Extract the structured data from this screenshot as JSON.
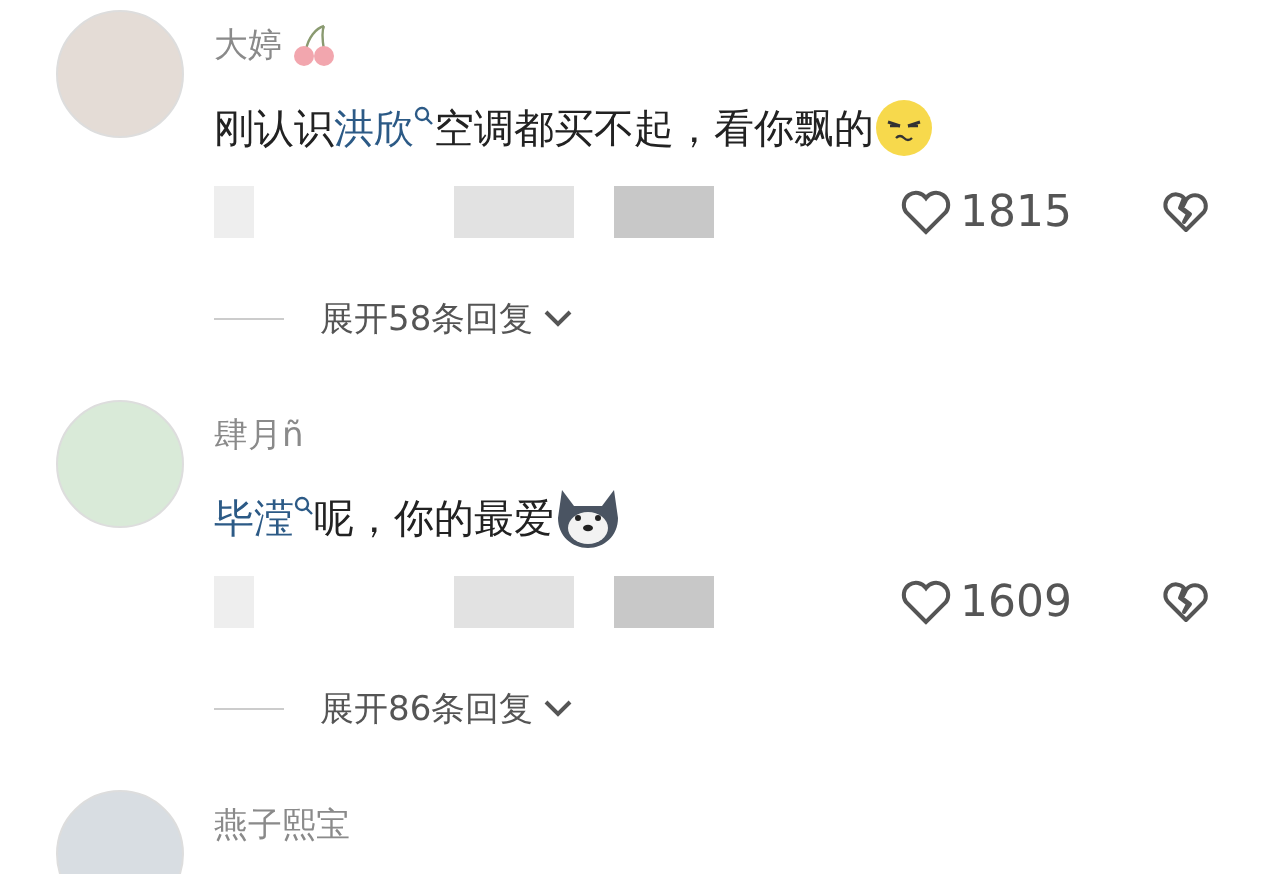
{
  "comments": [
    {
      "username": "大婷",
      "has_badge": true,
      "body": [
        {
          "kind": "text",
          "text": "刚认识"
        },
        {
          "kind": "mention",
          "text": "洪欣"
        },
        {
          "kind": "text",
          "text": "空调都买不起，看你飘的"
        },
        {
          "kind": "smiley"
        }
      ],
      "likes": "1815",
      "replies": "展开58条回复"
    },
    {
      "username": "肆月ñ",
      "has_badge": false,
      "body": [
        {
          "kind": "mention",
          "text": "毕滢"
        },
        {
          "kind": "text",
          "text": "呢，你的最爱"
        },
        {
          "kind": "dog"
        }
      ],
      "likes": "1609",
      "replies": "展开86条回复"
    },
    {
      "username": "燕子熙宝",
      "has_badge": false
    }
  ]
}
